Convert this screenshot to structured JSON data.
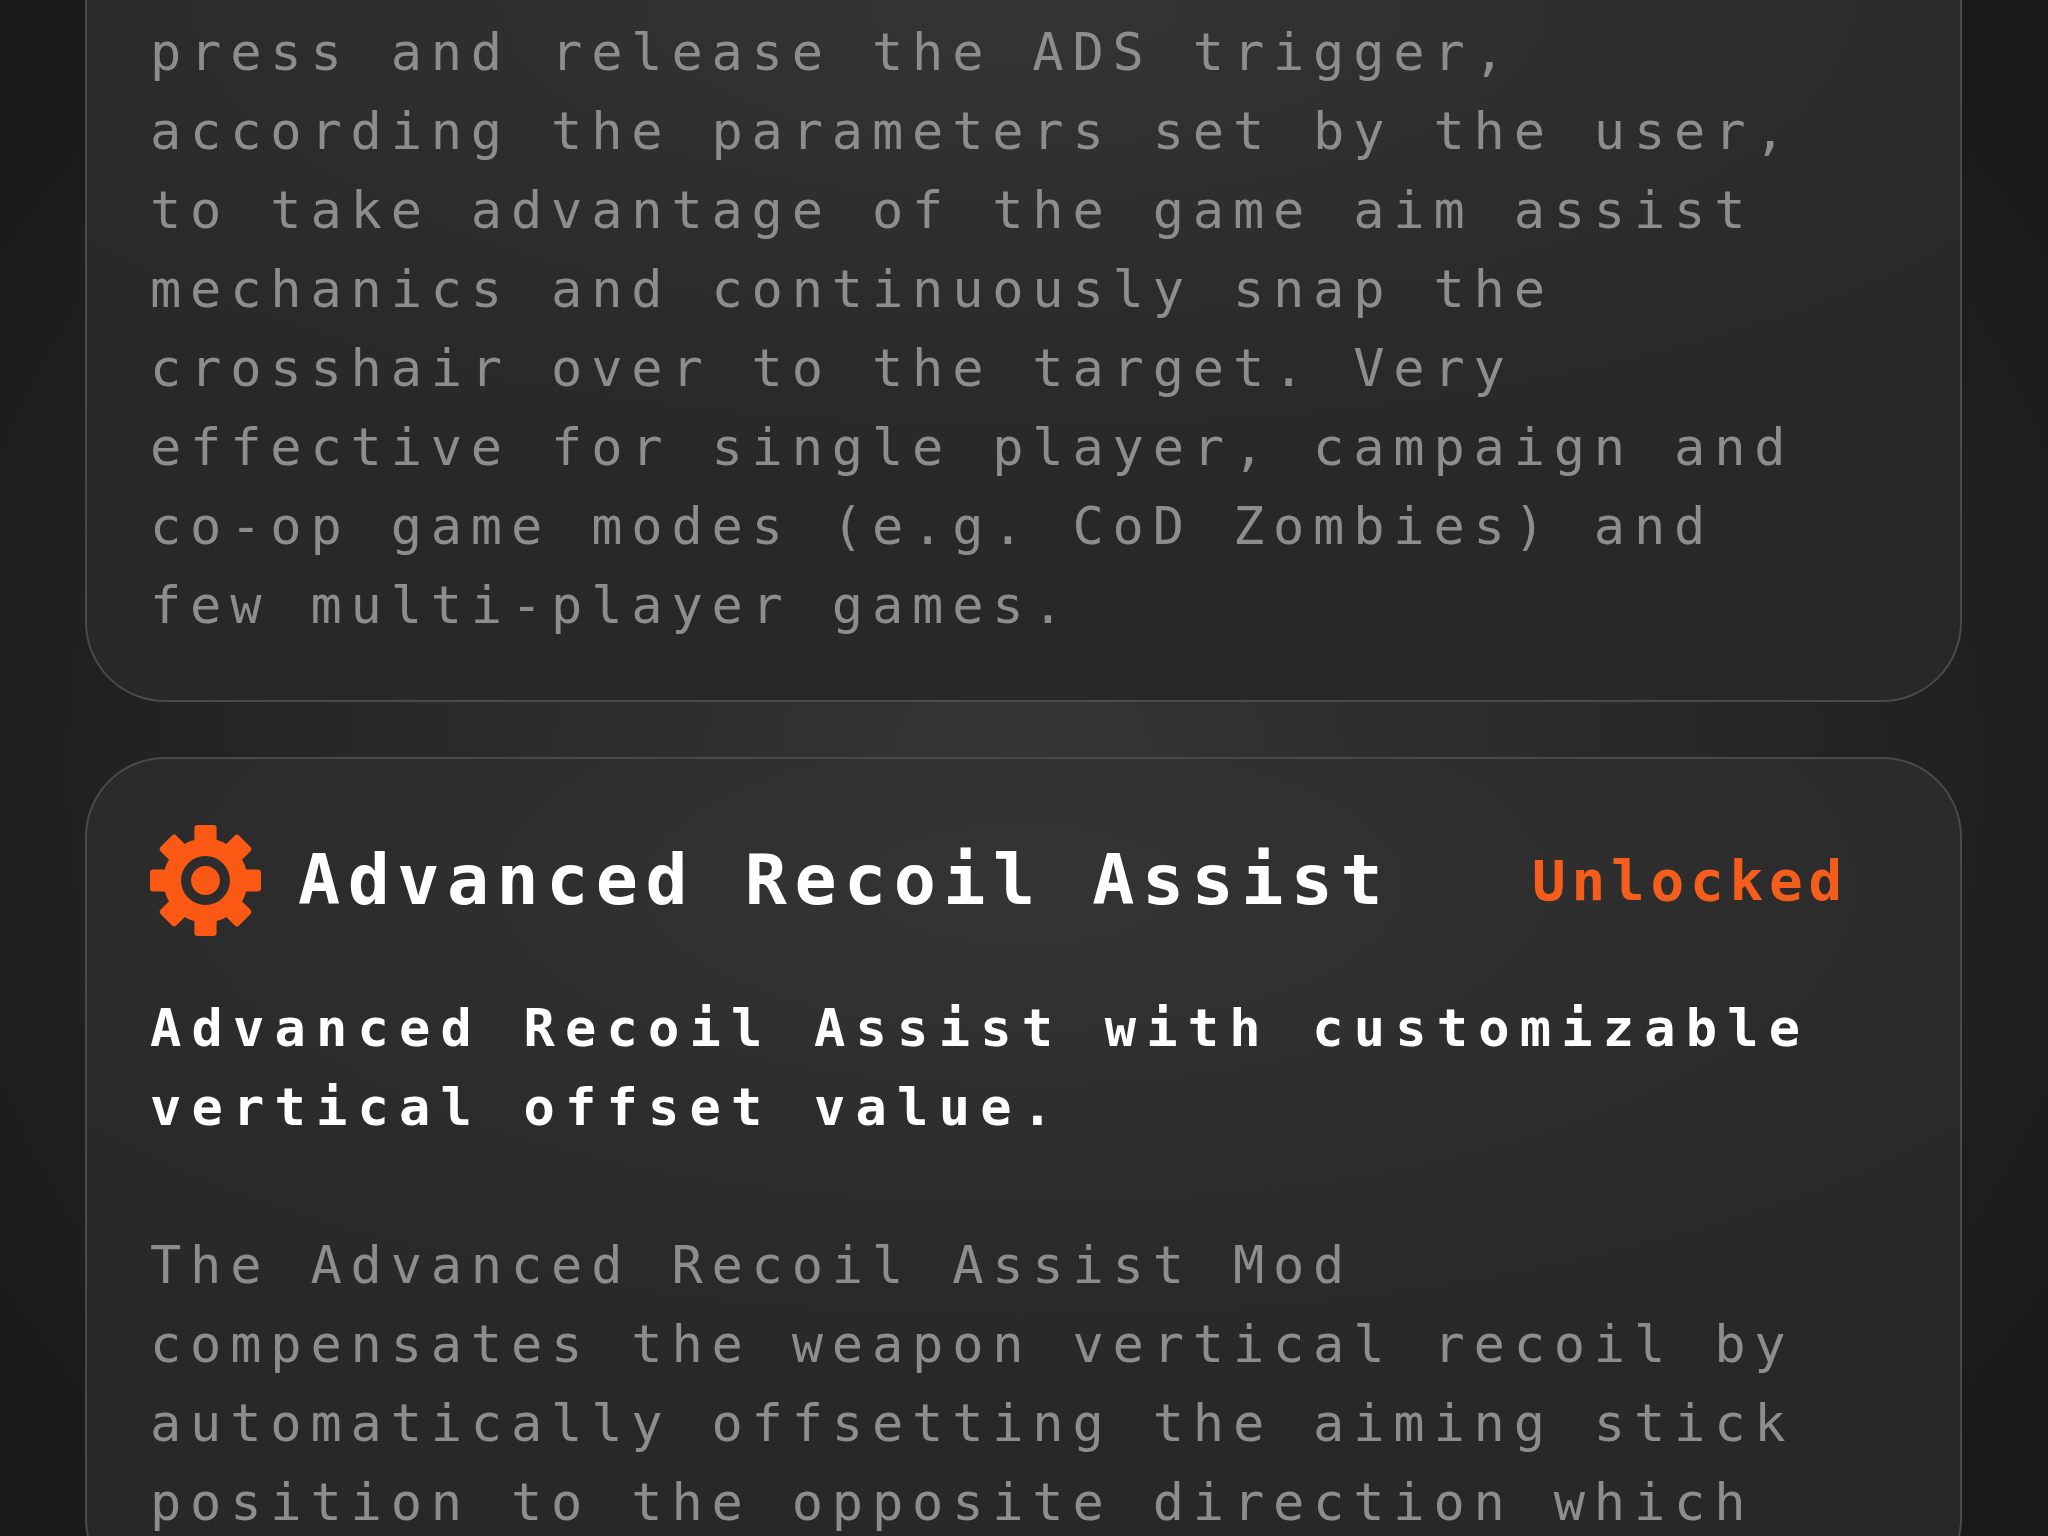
{
  "cards": [
    {
      "description": "press and release the ADS trigger,\naccording the parameters set by the user,\nto take advantage of the game aim assist\nmechanics and continuously snap the\ncrosshair over to the target. Very\neffective for single player, campaign and\nco-op game modes (e.g. CoD Zombies) and\nfew multi-player games."
    },
    {
      "title": "Advanced Recoil Assist",
      "status": "Unlocked",
      "summary": "Advanced Recoil Assist with customizable\nvertical offset value.",
      "description": "The Advanced Recoil Assist Mod\ncompensates the weapon vertical recoil by\nautomatically offsetting the aiming stick\nposition to the opposite direction which"
    }
  ]
}
